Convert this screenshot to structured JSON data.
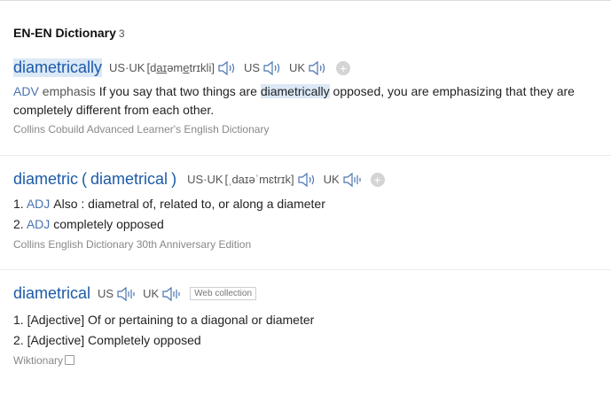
{
  "header": {
    "title": "EN-EN Dictionary",
    "count": "3"
  },
  "entries": [
    {
      "headword": "diametrically",
      "pron_us_uk_label": "US·UK",
      "ipa_pre": "[d",
      "ipa_u1": "aɪ",
      "ipa_mid1": "əm",
      "ipa_u2": "e",
      "ipa_post": "trɪkli]",
      "us_label": "US",
      "uk_label": "UK",
      "add_label": "+",
      "pos": "ADV",
      "pos2": "emphasis",
      "def_pre": "If you say that two things are ",
      "def_hl": "diametrically",
      "def_post": " opposed, you are emphasizing that they are completely different from each other.",
      "source": "Collins Cobuild Advanced Learner's English Dictionary"
    },
    {
      "headword": "diametric",
      "paren_open": "(",
      "alt": "diametrical",
      "paren_close": ")",
      "pron_us_uk_label": "US·UK",
      "ipa": "[ˌdaɪəˈmɛtrɪk]",
      "uk_label": "UK",
      "add_label": "+",
      "senses": [
        {
          "num": "1.",
          "pos": "ADJ",
          "text": "Also : diametral of, related to, or along a diameter"
        },
        {
          "num": "2.",
          "pos": "ADJ",
          "text": "completely opposed"
        }
      ],
      "source": "Collins English Dictionary 30th Anniversary Edition"
    },
    {
      "headword": "diametrical",
      "us_label": "US",
      "uk_label": "UK",
      "tag": "Web collection",
      "senses": [
        "1. [Adjective] Of or pertaining to a diagonal or diameter",
        "2. [Adjective] Completely opposed"
      ],
      "source": "Wiktionary"
    }
  ]
}
